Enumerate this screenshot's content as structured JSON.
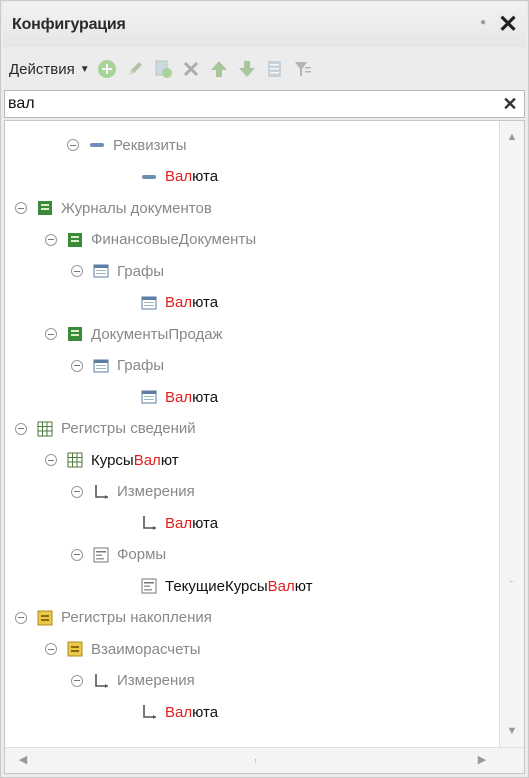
{
  "window": {
    "title": "Конфигурация"
  },
  "toolbar": {
    "actions_label": "Действия"
  },
  "search": {
    "value": "вал"
  },
  "tree": [
    {
      "pre": "Реквизиты",
      "hl": "",
      "post": "",
      "icon": "attribute-icon",
      "dark": false
    },
    {
      "pre": "",
      "hl": "Вал",
      "post": "юта",
      "icon": "attribute-icon",
      "dark": true
    },
    {
      "pre": "Журналы документов",
      "hl": "",
      "post": "",
      "icon": "journal-icon",
      "dark": false
    },
    {
      "pre": "ФинансовыеДокументы",
      "hl": "",
      "post": "",
      "icon": "journal-icon",
      "dark": false
    },
    {
      "pre": "Графы",
      "hl": "",
      "post": "",
      "icon": "column-icon",
      "dark": false
    },
    {
      "pre": "",
      "hl": "Вал",
      "post": "юта",
      "icon": "column-icon",
      "dark": true
    },
    {
      "pre": "ДокументыПродаж",
      "hl": "",
      "post": "",
      "icon": "journal-icon",
      "dark": false
    },
    {
      "pre": "Графы",
      "hl": "",
      "post": "",
      "icon": "column-icon",
      "dark": false
    },
    {
      "pre": "",
      "hl": "Вал",
      "post": "юта",
      "icon": "column-icon",
      "dark": true
    },
    {
      "pre": "Регистры сведений",
      "hl": "",
      "post": "",
      "icon": "register-info-icon",
      "dark": false
    },
    {
      "pre": "Курсы",
      "hl": "Вал",
      "post": "ют",
      "icon": "register-info-icon",
      "dark": true
    },
    {
      "pre": "Измерения",
      "hl": "",
      "post": "",
      "icon": "dimension-icon",
      "dark": false
    },
    {
      "pre": "",
      "hl": "Вал",
      "post": "юта",
      "icon": "dimension-icon",
      "dark": true
    },
    {
      "pre": "Формы",
      "hl": "",
      "post": "",
      "icon": "form-icon",
      "dark": false
    },
    {
      "pre": "ТекущиеКурсы",
      "hl": "Вал",
      "post": "ют",
      "icon": "form-icon",
      "dark": true
    },
    {
      "pre": "Регистры накопления",
      "hl": "",
      "post": "",
      "icon": "register-accum-icon",
      "dark": false
    },
    {
      "pre": "Взаиморасчеты",
      "hl": "",
      "post": "",
      "icon": "register-accum-icon",
      "dark": false
    },
    {
      "pre": "Измерения",
      "hl": "",
      "post": "",
      "icon": "dimension-icon",
      "dark": false
    },
    {
      "pre": "",
      "hl": "Вал",
      "post": "юта",
      "icon": "dimension-icon",
      "dark": true
    }
  ]
}
